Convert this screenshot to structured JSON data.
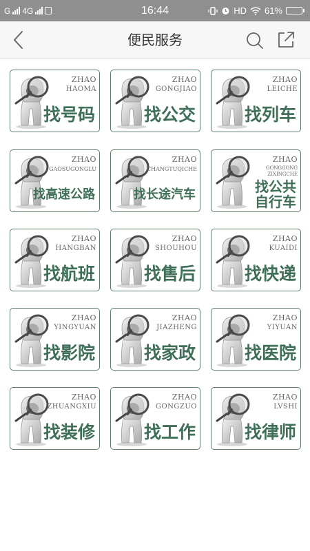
{
  "status_bar": {
    "carrier_left": "G",
    "carrier_right": "4G",
    "time": "16:44",
    "hd": "HD",
    "battery_percent": "61%",
    "battery_level": 0.61
  },
  "header": {
    "title": "便民服务",
    "back_icon": "chevron-left-icon",
    "search_icon": "search-icon",
    "share_icon": "share-icon"
  },
  "colors": {
    "status_bar_bg": "#8f8f8f",
    "card_border": "#5d7f6a",
    "card_text": "#3f6f58"
  },
  "services": [
    {
      "zhao": "ZHAO",
      "pinyin": "HAOMA",
      "label": "找号码"
    },
    {
      "zhao": "ZHAO",
      "pinyin": "GONGJIAO",
      "label": "找公交"
    },
    {
      "zhao": "ZHAO",
      "pinyin": "LEICHE",
      "label": "找列车"
    },
    {
      "zhao": "ZHAO",
      "pinyin": "GAOSUGONGLU",
      "label": "找高速公路"
    },
    {
      "zhao": "ZHAO",
      "pinyin": "CHANGTUQICHE",
      "label": "找长途汽车"
    },
    {
      "zhao": "ZHAO",
      "pinyin": "GONGGONG ZIXINGCHE",
      "label": "找公共 自行车"
    },
    {
      "zhao": "ZHAO",
      "pinyin": "HANGBAN",
      "label": "找航班"
    },
    {
      "zhao": "ZHAO",
      "pinyin": "SHOUHOU",
      "label": "找售后"
    },
    {
      "zhao": "ZHAO",
      "pinyin": "KUAIDI",
      "label": "找快递"
    },
    {
      "zhao": "ZHAO",
      "pinyin": "YINGYUAN",
      "label": "找影院"
    },
    {
      "zhao": "ZHAO",
      "pinyin": "JIAZHENG",
      "label": "找家政"
    },
    {
      "zhao": "ZHAO",
      "pinyin": "YIYUAN",
      "label": "找医院"
    },
    {
      "zhao": "ZHAO",
      "pinyin": "ZHUANGXIU",
      "label": "找装修"
    },
    {
      "zhao": "ZHAO",
      "pinyin": "GONGZUO",
      "label": "找工作"
    },
    {
      "zhao": "ZHAO",
      "pinyin": "LVSHI",
      "label": "找律师"
    }
  ]
}
